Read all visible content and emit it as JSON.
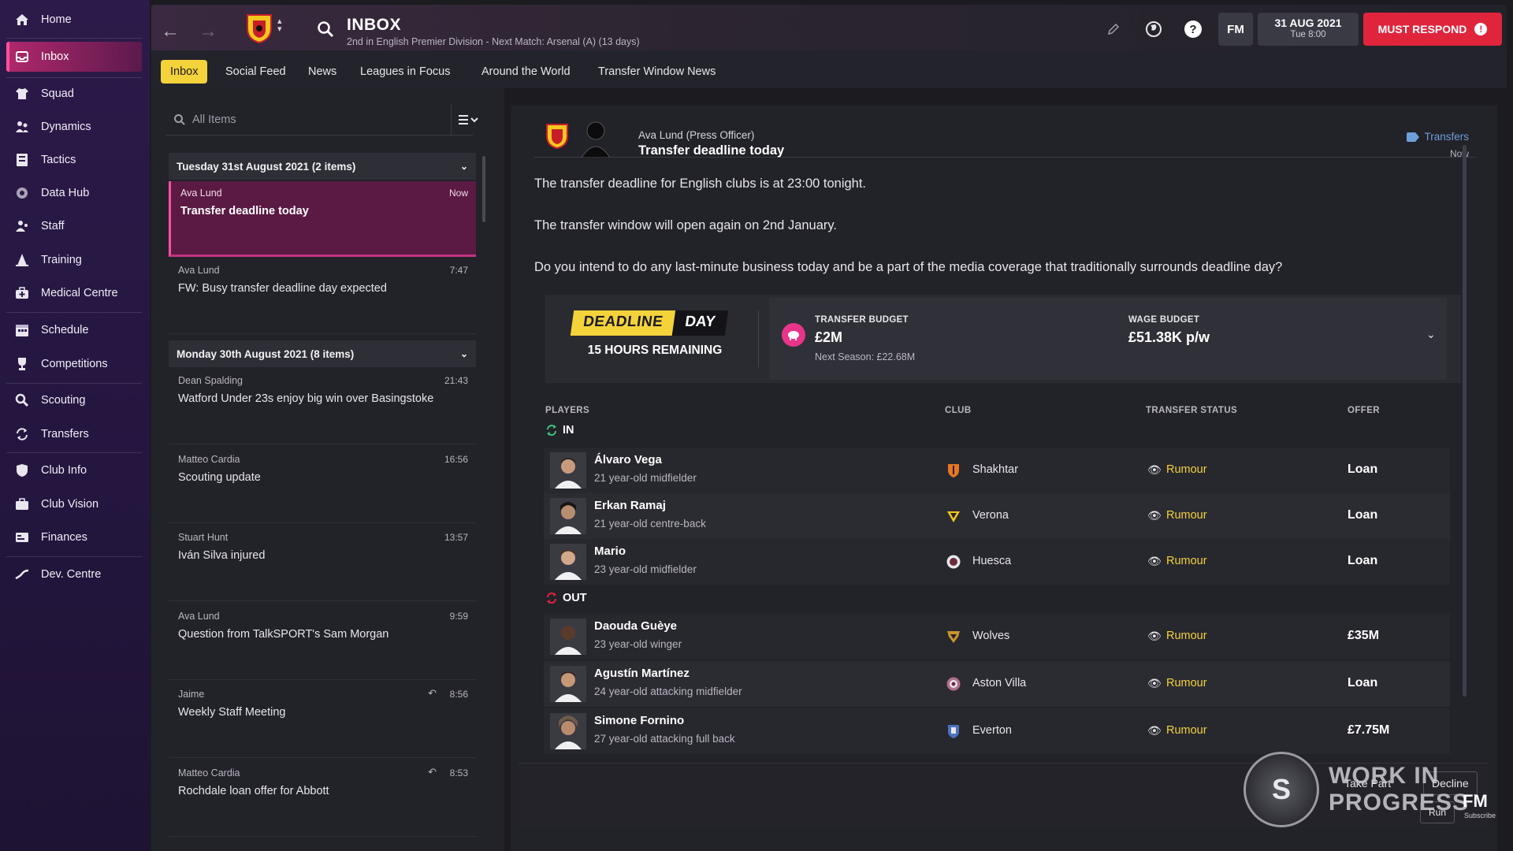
{
  "sidebar": {
    "items": [
      {
        "label": "Home",
        "icon": "home-icon"
      },
      {
        "label": "Inbox",
        "icon": "inbox-icon",
        "active": true
      },
      {
        "label": "Squad",
        "icon": "shirt-icon"
      },
      {
        "label": "Dynamics",
        "icon": "people-icon"
      },
      {
        "label": "Tactics",
        "icon": "tactics-board-icon"
      },
      {
        "label": "Data Hub",
        "icon": "data-hub-icon"
      },
      {
        "label": "Staff",
        "icon": "staff-icon"
      },
      {
        "label": "Training",
        "icon": "cone-icon"
      },
      {
        "label": "Medical Centre",
        "icon": "medical-bag-icon"
      },
      {
        "label": "Schedule",
        "icon": "calendar-icon"
      },
      {
        "label": "Competitions",
        "icon": "trophy-icon"
      },
      {
        "label": "Scouting",
        "icon": "magnifier-icon"
      },
      {
        "label": "Transfers",
        "icon": "transfer-arrows-icon"
      },
      {
        "label": "Club Info",
        "icon": "shield-icon"
      },
      {
        "label": "Club Vision",
        "icon": "briefcase-icon"
      },
      {
        "label": "Finances",
        "icon": "finance-icon"
      },
      {
        "label": "Dev. Centre",
        "icon": "dev-centre-icon"
      }
    ]
  },
  "header": {
    "title": "INBOX",
    "subtitle": "2nd in English Premier Division - Next Match: Arsenal (A) (13 days)",
    "fm_label": "FM",
    "date": "31 AUG 2021",
    "time": "Tue 8:00",
    "must_respond": "MUST RESPOND",
    "must_respond_mark": "!"
  },
  "tabs": [
    {
      "label": "Inbox",
      "active": true
    },
    {
      "label": "Social Feed"
    },
    {
      "label": "News"
    },
    {
      "label": "Leagues in Focus"
    },
    {
      "label": "Around the World"
    },
    {
      "label": "Transfer Window News"
    }
  ],
  "list": {
    "search_placeholder": "All Items",
    "groups": [
      {
        "title": "Tuesday 31st August 2021 (2 items)"
      },
      {
        "title": "Monday 30th August 2021 (8 items)"
      }
    ],
    "messages": [
      {
        "sender": "Ava Lund",
        "time": "Now",
        "subject": "Transfer deadline today"
      },
      {
        "sender": "Ava Lund",
        "time": "7:47",
        "subject": "FW: Busy transfer deadline day expected"
      },
      {
        "sender": "Dean Spalding",
        "time": "21:43",
        "subject": "Watford Under 23s enjoy big win over Basingstoke"
      },
      {
        "sender": "Matteo Cardia",
        "time": "16:56",
        "subject": "Scouting update"
      },
      {
        "sender": "Stuart Hunt",
        "time": "13:57",
        "subject": "Iván Silva injured"
      },
      {
        "sender": "Ava Lund",
        "time": "9:59",
        "subject": "Question from TalkSPORT's Sam Morgan"
      },
      {
        "sender": "Jaime",
        "time": "8:56",
        "subject": "Weekly Staff Meeting"
      },
      {
        "sender": "Matteo Cardia",
        "time": "8:53",
        "subject": "Rochdale loan offer for Abbott"
      }
    ]
  },
  "message": {
    "sender": "Ava Lund",
    "role": "(Press Officer)",
    "subject": "Transfer deadline today",
    "tag": "Transfers",
    "time": "Now",
    "paragraphs": [
      "The transfer deadline for English clubs is at 23:00 tonight.",
      "The transfer window will open again on 2nd January.",
      "Do you intend to do any last-minute business today and be a part of the media coverage that traditionally surrounds deadline day?"
    ],
    "deadline_left": "DEADLINE",
    "deadline_right": "DAY",
    "hours_remaining": "15 HOURS REMAINING",
    "transfer_budget_label": "TRANSFER BUDGET",
    "transfer_budget": "£2M",
    "next_season": "Next Season: £22.68M",
    "wage_budget_label": "WAGE BUDGET",
    "wage_budget": "£51.38K p/w",
    "columns": {
      "players": "PLAYERS",
      "club": "CLUB",
      "status": "TRANSFER STATUS",
      "offer": "OFFER"
    },
    "in_label": "IN",
    "out_label": "OUT",
    "players_in": [
      {
        "name": "Álvaro Vega",
        "desc": "21 year-old midfielder",
        "club": "Shakhtar",
        "status": "Rumour",
        "offer": "Loan",
        "club_color": "#e8771f"
      },
      {
        "name": "Erkan Ramaj",
        "desc": "21 year-old centre-back",
        "club": "Verona",
        "status": "Rumour",
        "offer": "Loan",
        "club_color": "#f4c81e"
      },
      {
        "name": "Mario",
        "desc": "23 year-old midfielder",
        "club": "Huesca",
        "status": "Rumour",
        "offer": "Loan",
        "club_color": "#9c9ca6"
      }
    ],
    "players_out": [
      {
        "name": "Daouda Guèye",
        "desc": "23 year-old winger",
        "club": "Wolves",
        "status": "Rumour",
        "offer": "£35M",
        "club_color": "#c8942a"
      },
      {
        "name": "Agustín Martínez",
        "desc": "24 year-old attacking midfielder",
        "club": "Aston Villa",
        "status": "Rumour",
        "offer": "Loan",
        "club_color": "#b0708c"
      },
      {
        "name": "Simone Fornino",
        "desc": "27 year-old attacking full back",
        "club": "Everton",
        "status": "Rumour",
        "offer": "£7.75M",
        "club_color": "#4a72c0"
      }
    ],
    "take_part": "Take Part",
    "decline": "Decline",
    "run": "Run"
  },
  "watermark": {
    "line1": "WORK IN",
    "line2": "PROGRESS",
    "badge": "FM",
    "subscribe": "Subscribe"
  },
  "colors": {
    "accent_yellow": "#f4d23a",
    "accent_pink": "#ff4fa0",
    "must_respond_red": "#e0243c",
    "tag_blue": "#6d9fd8"
  }
}
